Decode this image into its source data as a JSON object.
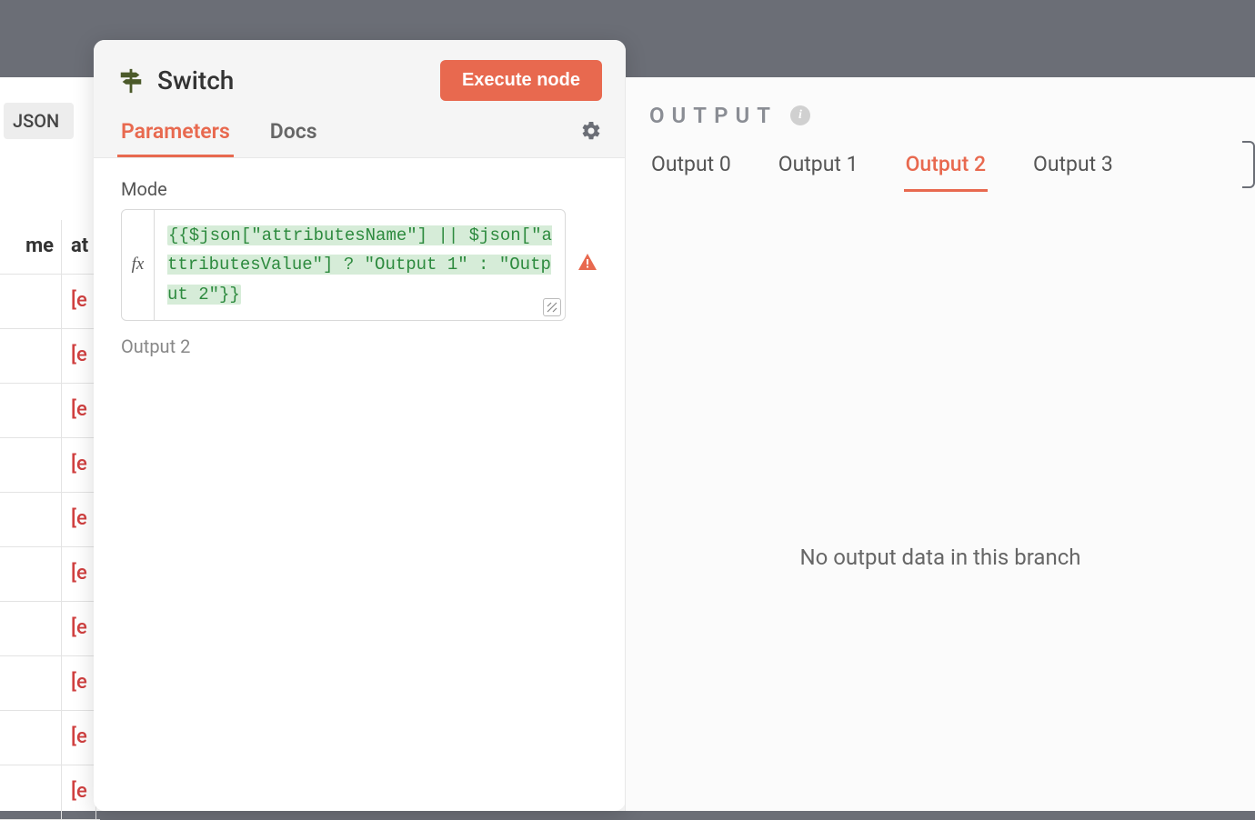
{
  "background": {
    "json_badge": "JSON",
    "header1": "me",
    "header2": "at",
    "row_value": "[e"
  },
  "modal": {
    "title": "Switch",
    "execute_label": "Execute node",
    "tabs": {
      "parameters": "Parameters",
      "docs": "Docs"
    },
    "param_label": "Mode",
    "fx_label": "fx",
    "expression": "{{$json[\"attributesName\"] || $json[\"attributesValue\"] ? \"Output 1\" : \"Output 2\"}}",
    "result": "Output 2"
  },
  "output": {
    "heading": "OUTPUT",
    "tabs": [
      "Output 0",
      "Output 1",
      "Output 2",
      "Output 3"
    ],
    "active_index": 2,
    "empty_message": "No output data in this branch"
  }
}
